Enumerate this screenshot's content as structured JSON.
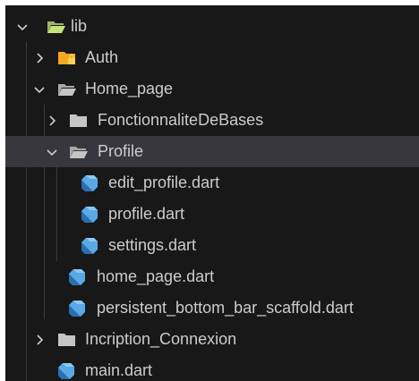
{
  "explorer": {
    "root": {
      "label": "lib",
      "state": "expanded",
      "icon": "folder-open-icon",
      "icon_color": "#c5e478"
    },
    "items": [
      {
        "label": "Auth",
        "state": "collapsed",
        "icon": "folder-lock-icon",
        "icon_color": "#f5a623"
      },
      {
        "label": "Home_page",
        "state": "expanded",
        "icon": "folder-open-icon",
        "icon_color": "#c5c5c5"
      },
      {
        "label": "FonctionnaliteDeBases",
        "state": "collapsed",
        "icon": "folder-icon",
        "icon_color": "#c5c5c5"
      },
      {
        "label": "Profile",
        "state": "expanded",
        "icon": "folder-open-icon",
        "icon_color": "#c5c5c5",
        "selected": true
      },
      {
        "label": "edit_profile.dart",
        "icon": "dart-file-icon",
        "icon_color": "#5aa9e6"
      },
      {
        "label": "profile.dart",
        "icon": "dart-file-icon",
        "icon_color": "#5aa9e6"
      },
      {
        "label": "settings.dart",
        "icon": "dart-file-icon",
        "icon_color": "#5aa9e6"
      },
      {
        "label": "home_page.dart",
        "icon": "dart-file-icon",
        "icon_color": "#5aa9e6"
      },
      {
        "label": "persistent_bottom_bar_scaffold.dart",
        "icon": "dart-file-icon",
        "icon_color": "#5aa9e6"
      },
      {
        "label": "Incription_Connexion",
        "state": "collapsed",
        "icon": "folder-icon",
        "icon_color": "#c5c5c5"
      },
      {
        "label": "main.dart",
        "icon": "dart-file-icon",
        "icon_color": "#5aa9e6"
      }
    ]
  },
  "colors": {
    "background": "#181818",
    "selected_row": "#37373d",
    "text": "#cccccc",
    "indent_guide": "#3b3b3b"
  }
}
